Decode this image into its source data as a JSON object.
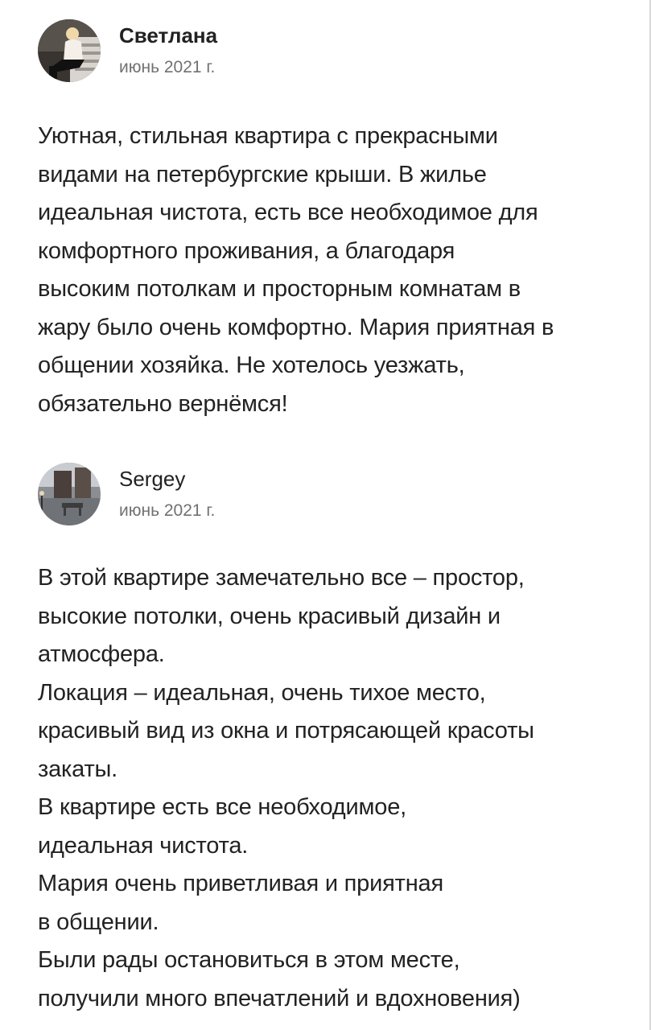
{
  "reviews": [
    {
      "author": "Светлана",
      "date": "июнь 2021 г.",
      "avatar": "user-photo-woman-sitting",
      "text": "Уютная, стильная квартира с прекрасными\nвидами на петербургские крыши. В жилье\nидеальная чистота, есть все необходимое для\nкомфортного проживания, а благодаря\nвысоким потолкам и просторным комнатам в\nжару было очень комфортно. Мария приятная в\nобщении хозяйка. Не хотелось уезжать,\nобязательно вернёмся!"
    },
    {
      "author": "Sergey",
      "date": "июнь 2021 г.",
      "avatar": "user-photo-street-scene",
      "text": "В этой квартире замечательно все – простор,\nвысокие потолки, очень красивый дизайн и\nатмосфера.\nЛокация – идеальная, очень тихое место,\nкрасивый вид из окна и потрясающей красоты\nзакаты.\nВ квартире есть все необходимое,\nидеальная чистота.\nМария очень приветливая и приятная\nв общении.\nБыли рады остановиться в этом месте,\nполучили много впечатлений и вдохновения)"
    }
  ],
  "colors": {
    "text": "#222222",
    "secondary_text": "#717171",
    "background": "#ffffff"
  }
}
